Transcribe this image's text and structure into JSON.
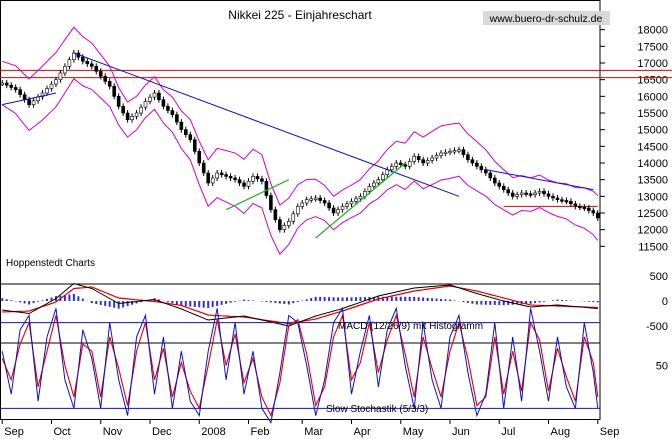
{
  "chart_data": [
    {
      "type": "candlestick",
      "title": "Nikkei 225 - Einjahreschart",
      "watermark": "www.buero-dr-schulz.de",
      "source_label": "Hoppenstedt Charts",
      "months": [
        "Sep",
        "Oct",
        "Nov",
        "Dec",
        "2008",
        "Feb",
        "Mar",
        "Apr",
        "May",
        "Jun",
        "Jul",
        "Aug",
        "Sep"
      ],
      "y_ticks": [
        11500,
        12000,
        12500,
        13000,
        13500,
        14000,
        14500,
        15000,
        15500,
        16000,
        16500,
        17000,
        17500,
        18000
      ],
      "ylim": [
        11150,
        18350
      ],
      "price_path": [
        [
          0,
          16400
        ],
        [
          3,
          16200
        ],
        [
          6,
          15750
        ],
        [
          9,
          16100
        ],
        [
          12,
          16500
        ],
        [
          15,
          17100
        ],
        [
          16,
          17300
        ],
        [
          18,
          17050
        ],
        [
          20,
          16900
        ],
        [
          22,
          16600
        ],
        [
          24,
          16300
        ],
        [
          26,
          15700
        ],
        [
          28,
          15300
        ],
        [
          30,
          15500
        ],
        [
          32,
          15850
        ],
        [
          34,
          16100
        ],
        [
          36,
          15700
        ],
        [
          38,
          15450
        ],
        [
          40,
          15000
        ],
        [
          42,
          14700
        ],
        [
          44,
          14000
        ],
        [
          46,
          13400
        ],
        [
          48,
          13700
        ],
        [
          50,
          13600
        ],
        [
          52,
          13500
        ],
        [
          54,
          13300
        ],
        [
          56,
          13600
        ],
        [
          58,
          13450
        ],
        [
          60,
          12600
        ],
        [
          62,
          12000
        ],
        [
          64,
          12250
        ],
        [
          66,
          12700
        ],
        [
          68,
          12900
        ],
        [
          70,
          12950
        ],
        [
          72,
          12800
        ],
        [
          74,
          12500
        ],
        [
          76,
          12700
        ],
        [
          78,
          12850
        ],
        [
          80,
          13000
        ],
        [
          82,
          13300
        ],
        [
          84,
          13500
        ],
        [
          86,
          13800
        ],
        [
          88,
          14000
        ],
        [
          90,
          13900
        ],
        [
          92,
          14200
        ],
        [
          94,
          14000
        ],
        [
          96,
          14150
        ],
        [
          98,
          14300
        ],
        [
          100,
          14350
        ],
        [
          102,
          14400
        ],
        [
          104,
          14100
        ],
        [
          106,
          13900
        ],
        [
          108,
          13700
        ],
        [
          110,
          13400
        ],
        [
          112,
          13200
        ],
        [
          114,
          13000
        ],
        [
          116,
          13100
        ],
        [
          118,
          13050
        ],
        [
          120,
          13150
        ],
        [
          122,
          13000
        ],
        [
          124,
          12900
        ],
        [
          126,
          12850
        ],
        [
          128,
          12700
        ],
        [
          130,
          12650
        ],
        [
          132,
          12500
        ],
        [
          133,
          12350
        ]
      ],
      "bands_offset": 650,
      "horizontal_lines_red": [
        16780,
        16560
      ],
      "support_line_red": [
        12700,
        13150
      ],
      "trendlines_blue": [
        {
          "from": [
            0,
            15750
          ],
          "to": [
            12,
            16100
          ]
        },
        {
          "from": [
            16,
            17300
          ],
          "to": [
            102,
            13000
          ]
        },
        {
          "from": [
            108,
            13800
          ],
          "to": [
            132,
            13200
          ]
        }
      ],
      "trendlines_green": [
        {
          "from": [
            50,
            12600
          ],
          "to": [
            64,
            13500
          ]
        },
        {
          "from": [
            70,
            11750
          ],
          "to": [
            90,
            14000
          ]
        }
      ]
    },
    {
      "type": "bar-line",
      "label": "MACD (12/26/9) mit Histogramm",
      "y_ticks": [
        500,
        0,
        -500
      ],
      "macd_path": [
        [
          0,
          -180
        ],
        [
          6,
          -250
        ],
        [
          12,
          50
        ],
        [
          16,
          350
        ],
        [
          20,
          250
        ],
        [
          26,
          -50
        ],
        [
          34,
          30
        ],
        [
          40,
          -160
        ],
        [
          46,
          -380
        ],
        [
          54,
          -300
        ],
        [
          60,
          -420
        ],
        [
          64,
          -500
        ],
        [
          70,
          -300
        ],
        [
          76,
          -150
        ],
        [
          84,
          100
        ],
        [
          92,
          260
        ],
        [
          100,
          320
        ],
        [
          106,
          150
        ],
        [
          112,
          0
        ],
        [
          118,
          -120
        ],
        [
          124,
          -80
        ],
        [
          133,
          -150
        ]
      ],
      "signal_path": [
        [
          0,
          -220
        ],
        [
          6,
          -200
        ],
        [
          12,
          -20
        ],
        [
          16,
          250
        ],
        [
          20,
          280
        ],
        [
          26,
          60
        ],
        [
          34,
          -10
        ],
        [
          40,
          -90
        ],
        [
          46,
          -280
        ],
        [
          54,
          -320
        ],
        [
          60,
          -400
        ],
        [
          64,
          -450
        ],
        [
          70,
          -360
        ],
        [
          76,
          -200
        ],
        [
          84,
          40
        ],
        [
          92,
          200
        ],
        [
          100,
          300
        ],
        [
          106,
          200
        ],
        [
          112,
          60
        ],
        [
          118,
          -80
        ],
        [
          124,
          -100
        ],
        [
          133,
          -130
        ]
      ]
    },
    {
      "type": "line",
      "label": "Slow Stochastik (5/3/3)",
      "y_ticks": [
        50
      ],
      "levels": [
        80,
        20
      ],
      "k_path": [
        [
          0,
          60
        ],
        [
          2,
          30
        ],
        [
          4,
          75
        ],
        [
          6,
          85
        ],
        [
          8,
          25
        ],
        [
          10,
          70
        ],
        [
          12,
          90
        ],
        [
          14,
          40
        ],
        [
          16,
          20
        ],
        [
          18,
          75
        ],
        [
          20,
          55
        ],
        [
          22,
          20
        ],
        [
          24,
          80
        ],
        [
          26,
          40
        ],
        [
          28,
          15
        ],
        [
          30,
          70
        ],
        [
          32,
          85
        ],
        [
          34,
          30
        ],
        [
          36,
          70
        ],
        [
          38,
          20
        ],
        [
          40,
          60
        ],
        [
          42,
          25
        ],
        [
          44,
          15
        ],
        [
          46,
          60
        ],
        [
          48,
          90
        ],
        [
          50,
          40
        ],
        [
          52,
          80
        ],
        [
          54,
          30
        ],
        [
          56,
          60
        ],
        [
          58,
          20
        ],
        [
          60,
          10
        ],
        [
          62,
          45
        ],
        [
          64,
          85
        ],
        [
          66,
          80
        ],
        [
          68,
          50
        ],
        [
          70,
          15
        ],
        [
          72,
          40
        ],
        [
          74,
          80
        ],
        [
          76,
          90
        ],
        [
          78,
          30
        ],
        [
          80,
          60
        ],
        [
          82,
          85
        ],
        [
          84,
          35
        ],
        [
          86,
          75
        ],
        [
          88,
          90
        ],
        [
          90,
          50
        ],
        [
          92,
          20
        ],
        [
          94,
          80
        ],
        [
          96,
          40
        ],
        [
          98,
          20
        ],
        [
          100,
          70
        ],
        [
          102,
          85
        ],
        [
          104,
          45
        ],
        [
          106,
          15
        ],
        [
          108,
          30
        ],
        [
          110,
          80
        ],
        [
          112,
          20
        ],
        [
          114,
          70
        ],
        [
          116,
          25
        ],
        [
          118,
          90
        ],
        [
          120,
          60
        ],
        [
          122,
          25
        ],
        [
          124,
          70
        ],
        [
          126,
          35
        ],
        [
          128,
          20
        ],
        [
          130,
          80
        ],
        [
          132,
          45
        ],
        [
          133,
          20
        ]
      ],
      "d_path": [
        [
          0,
          55
        ],
        [
          2,
          40
        ],
        [
          4,
          65
        ],
        [
          6,
          80
        ],
        [
          8,
          35
        ],
        [
          10,
          60
        ],
        [
          12,
          85
        ],
        [
          14,
          50
        ],
        [
          16,
          28
        ],
        [
          18,
          65
        ],
        [
          20,
          60
        ],
        [
          22,
          28
        ],
        [
          24,
          70
        ],
        [
          26,
          48
        ],
        [
          28,
          22
        ],
        [
          30,
          60
        ],
        [
          32,
          80
        ],
        [
          34,
          40
        ],
        [
          36,
          62
        ],
        [
          38,
          28
        ],
        [
          40,
          52
        ],
        [
          42,
          32
        ],
        [
          44,
          20
        ],
        [
          46,
          50
        ],
        [
          48,
          82
        ],
        [
          50,
          50
        ],
        [
          52,
          72
        ],
        [
          54,
          38
        ],
        [
          56,
          55
        ],
        [
          58,
          28
        ],
        [
          60,
          15
        ],
        [
          62,
          38
        ],
        [
          64,
          78
        ],
        [
          66,
          82
        ],
        [
          68,
          58
        ],
        [
          70,
          22
        ],
        [
          72,
          35
        ],
        [
          74,
          70
        ],
        [
          76,
          85
        ],
        [
          78,
          40
        ],
        [
          80,
          52
        ],
        [
          82,
          80
        ],
        [
          84,
          45
        ],
        [
          86,
          68
        ],
        [
          88,
          85
        ],
        [
          90,
          58
        ],
        [
          92,
          28
        ],
        [
          94,
          70
        ],
        [
          96,
          48
        ],
        [
          98,
          28
        ],
        [
          100,
          60
        ],
        [
          102,
          80
        ],
        [
          104,
          55
        ],
        [
          106,
          22
        ],
        [
          108,
          28
        ],
        [
          110,
          70
        ],
        [
          112,
          30
        ],
        [
          114,
          60
        ],
        [
          116,
          32
        ],
        [
          118,
          80
        ],
        [
          120,
          68
        ],
        [
          122,
          32
        ],
        [
          124,
          62
        ],
        [
          126,
          42
        ],
        [
          128,
          25
        ],
        [
          130,
          70
        ],
        [
          132,
          52
        ],
        [
          133,
          28
        ]
      ]
    }
  ]
}
